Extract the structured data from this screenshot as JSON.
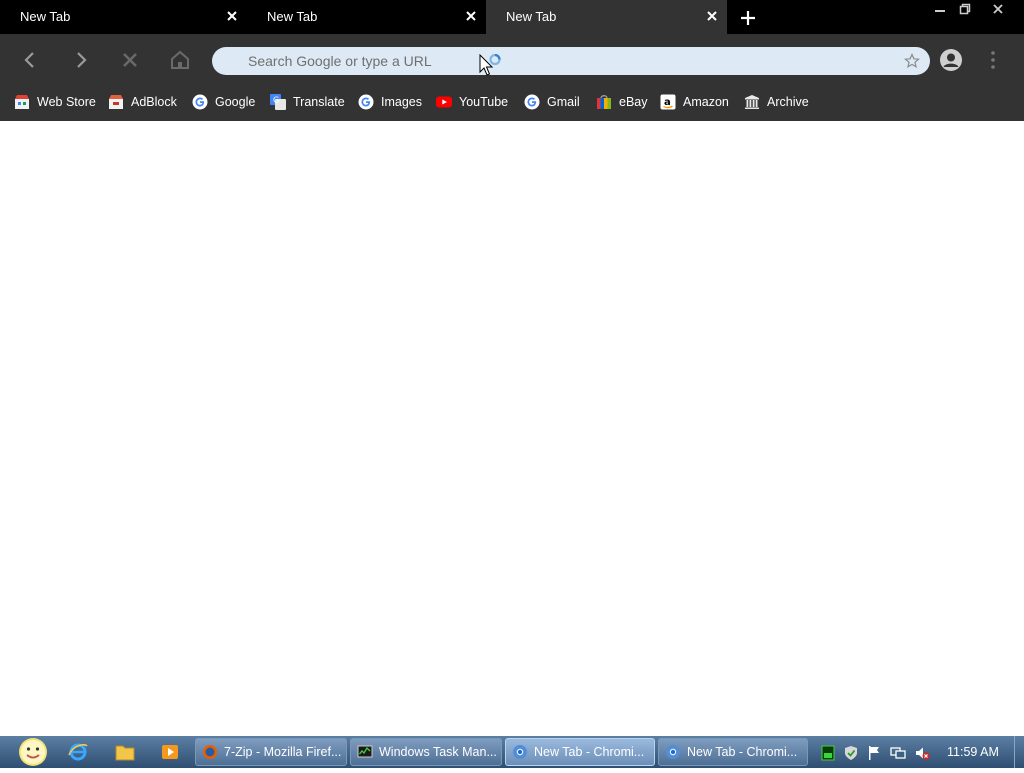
{
  "tabs": [
    {
      "title": "New Tab",
      "active": false
    },
    {
      "title": "New Tab",
      "active": false
    },
    {
      "title": "New Tab",
      "active": true
    }
  ],
  "omnibox": {
    "placeholder": "Search Google or type a URL",
    "value": ""
  },
  "bookmarks": [
    {
      "label": "Web Store",
      "icon": "web-store-icon"
    },
    {
      "label": "AdBlock",
      "icon": "adblock-icon"
    },
    {
      "label": "Google",
      "icon": "google-icon"
    },
    {
      "label": "Translate",
      "icon": "translate-icon"
    },
    {
      "label": "Images",
      "icon": "google-icon"
    },
    {
      "label": "YouTube",
      "icon": "youtube-icon"
    },
    {
      "label": "Gmail",
      "icon": "google-icon"
    },
    {
      "label": "eBay",
      "icon": "ebay-icon"
    },
    {
      "label": "Amazon",
      "icon": "amazon-icon"
    },
    {
      "label": "Archive",
      "icon": "archive-icon"
    }
  ],
  "taskbar": {
    "tasks": [
      {
        "label": "7-Zip - Mozilla Firef...",
        "icon": "firefox-icon",
        "active": false
      },
      {
        "label": "Windows Task Man...",
        "icon": "task-manager-icon",
        "active": false
      },
      {
        "label": "New Tab - Chromi...",
        "icon": "chromium-icon",
        "active": true
      },
      {
        "label": "New Tab - Chromi...",
        "icon": "chromium-icon",
        "active": false
      }
    ],
    "clock": "11:59 AM"
  },
  "colors": {
    "tabstrip": "#000000",
    "toolbar": "#333333",
    "omnibox": "#ddeaf5",
    "taskbar": "#3d6085",
    "page": "#ffffff"
  }
}
